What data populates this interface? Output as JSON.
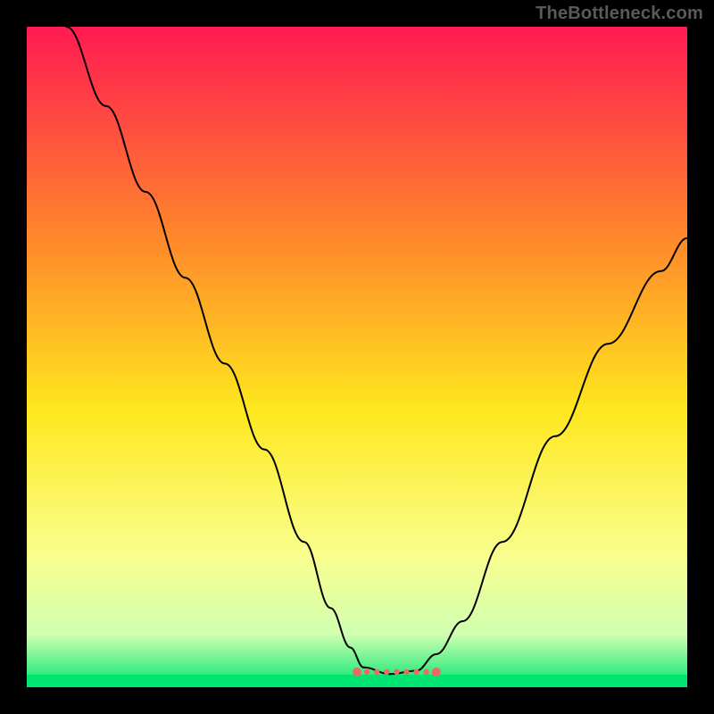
{
  "watermark": "TheBottleneck.com",
  "colors": {
    "frame": "#000000",
    "curve": "#000000",
    "marker": "#ea6a64",
    "grad_top": "#ff1a52",
    "grad_mid1": "#ff8b2a",
    "grad_mid2": "#ffe71e",
    "grad_low1": "#f9ff8e",
    "grad_low2": "#d0ffb0",
    "grad_bottom": "#00e571"
  },
  "chart_data": {
    "type": "line",
    "title": "",
    "xlabel": "",
    "ylabel": "",
    "xlim": [
      0,
      100
    ],
    "ylim": [
      0,
      100
    ],
    "curve_points": [
      [
        6,
        100
      ],
      [
        12,
        88
      ],
      [
        18,
        75
      ],
      [
        24,
        62
      ],
      [
        30,
        49
      ],
      [
        36,
        36
      ],
      [
        42,
        22
      ],
      [
        46,
        12
      ],
      [
        49,
        6
      ],
      [
        51,
        3
      ],
      [
        55,
        2
      ],
      [
        59,
        2.5
      ],
      [
        62,
        5
      ],
      [
        66,
        10
      ],
      [
        72,
        22
      ],
      [
        80,
        38
      ],
      [
        88,
        52
      ],
      [
        96,
        63
      ],
      [
        100,
        68
      ]
    ],
    "markers_x_range": [
      50,
      62
    ],
    "markers_y": 2.3,
    "notes": "V-shaped bottleneck curve over rainbow vertical gradient; plateau of dotted markers near the minimum."
  }
}
